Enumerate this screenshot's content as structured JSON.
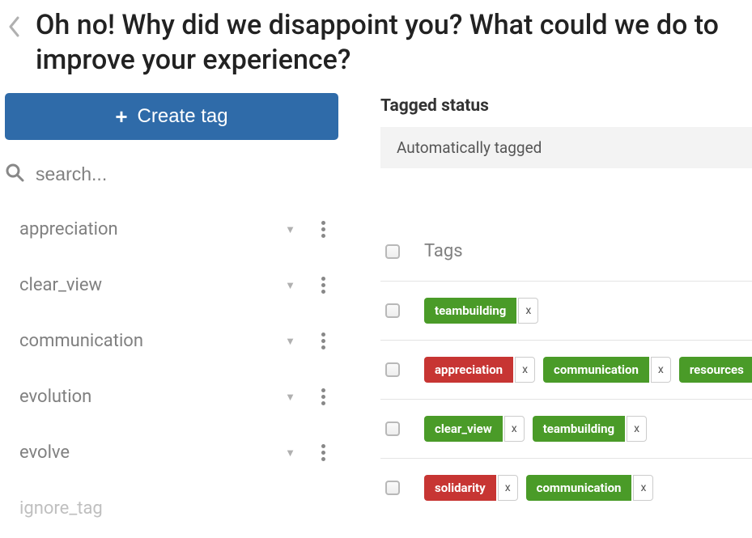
{
  "header": {
    "title": "Oh no! Why did we disappoint you? What could we do to improve your experience?"
  },
  "sidebar": {
    "create_label": "Create tag",
    "search_placeholder": "search...",
    "items": [
      {
        "label": "appreciation"
      },
      {
        "label": "clear_view"
      },
      {
        "label": "communication"
      },
      {
        "label": "evolution"
      },
      {
        "label": "evolve"
      },
      {
        "label": "ignore_tag"
      }
    ]
  },
  "main": {
    "status_header": "Tagged status",
    "status_value": "Automatically tagged",
    "tags_header": "Tags",
    "chip_x": "x",
    "rows": [
      {
        "tags": [
          {
            "label": "teambuilding",
            "color": "green"
          }
        ]
      },
      {
        "tags": [
          {
            "label": "appreciation",
            "color": "red"
          },
          {
            "label": "communication",
            "color": "green"
          },
          {
            "label": "resources",
            "color": "green"
          }
        ]
      },
      {
        "tags": [
          {
            "label": "clear_view",
            "color": "green"
          },
          {
            "label": "teambuilding",
            "color": "green"
          }
        ]
      },
      {
        "tags": [
          {
            "label": "solidarity",
            "color": "red"
          },
          {
            "label": "communication",
            "color": "green"
          }
        ]
      }
    ]
  }
}
